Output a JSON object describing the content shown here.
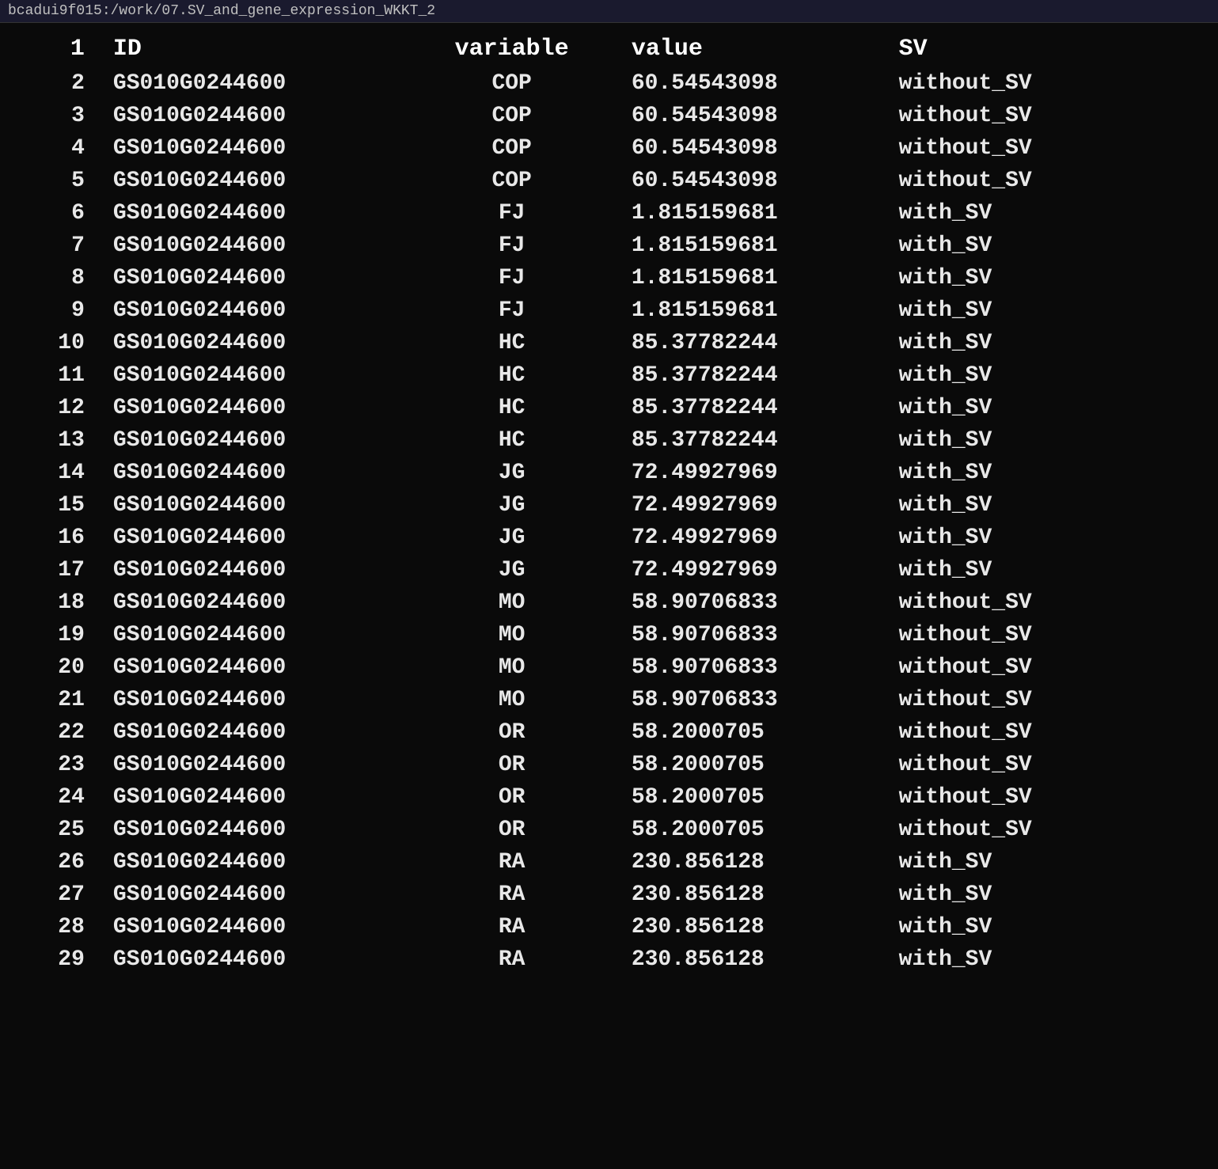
{
  "title_bar": {
    "text": "bcadui9f015:/work/07.SV_and_gene_expression_WKKT_2"
  },
  "table": {
    "headers": [
      "ID",
      "variable",
      "value",
      "SV"
    ],
    "rows": [
      {
        "id": "2",
        "gene": "GS010G0244600",
        "variable": "COP",
        "value": "60.54543098",
        "sv": "without_SV"
      },
      {
        "id": "3",
        "gene": "GS010G0244600",
        "variable": "COP",
        "value": "60.54543098",
        "sv": "without_SV"
      },
      {
        "id": "4",
        "gene": "GS010G0244600",
        "variable": "COP",
        "value": "60.54543098",
        "sv": "without_SV"
      },
      {
        "id": "5",
        "gene": "GS010G0244600",
        "variable": "COP",
        "value": "60.54543098",
        "sv": "without_SV"
      },
      {
        "id": "6",
        "gene": "GS010G0244600",
        "variable": "FJ",
        "value": "1.815159681",
        "sv": "with_SV"
      },
      {
        "id": "7",
        "gene": "GS010G0244600",
        "variable": "FJ",
        "value": "1.815159681",
        "sv": "with_SV"
      },
      {
        "id": "8",
        "gene": "GS010G0244600",
        "variable": "FJ",
        "value": "1.815159681",
        "sv": "with_SV"
      },
      {
        "id": "9",
        "gene": "GS010G0244600",
        "variable": "FJ",
        "value": "1.815159681",
        "sv": "with_SV"
      },
      {
        "id": "10",
        "gene": "GS010G0244600",
        "variable": "HC",
        "value": "85.37782244",
        "sv": "with_SV"
      },
      {
        "id": "11",
        "gene": "GS010G0244600",
        "variable": "HC",
        "value": "85.37782244",
        "sv": "with_SV"
      },
      {
        "id": "12",
        "gene": "GS010G0244600",
        "variable": "HC",
        "value": "85.37782244",
        "sv": "with_SV"
      },
      {
        "id": "13",
        "gene": "GS010G0244600",
        "variable": "HC",
        "value": "85.37782244",
        "sv": "with_SV"
      },
      {
        "id": "14",
        "gene": "GS010G0244600",
        "variable": "JG",
        "value": "72.49927969",
        "sv": "with_SV"
      },
      {
        "id": "15",
        "gene": "GS010G0244600",
        "variable": "JG",
        "value": "72.49927969",
        "sv": "with_SV"
      },
      {
        "id": "16",
        "gene": "GS010G0244600",
        "variable": "JG",
        "value": "72.49927969",
        "sv": "with_SV"
      },
      {
        "id": "17",
        "gene": "GS010G0244600",
        "variable": "JG",
        "value": "72.49927969",
        "sv": "with_SV"
      },
      {
        "id": "18",
        "gene": "GS010G0244600",
        "variable": "MO",
        "value": "58.90706833",
        "sv": "without_SV"
      },
      {
        "id": "19",
        "gene": "GS010G0244600",
        "variable": "MO",
        "value": "58.90706833",
        "sv": "without_SV"
      },
      {
        "id": "20",
        "gene": "GS010G0244600",
        "variable": "MO",
        "value": "58.90706833",
        "sv": "without_SV"
      },
      {
        "id": "21",
        "gene": "GS010G0244600",
        "variable": "MO",
        "value": "58.90706833",
        "sv": "without_SV"
      },
      {
        "id": "22",
        "gene": "GS010G0244600",
        "variable": "OR",
        "value": "58.2000705",
        "sv": "without_SV"
      },
      {
        "id": "23",
        "gene": "GS010G0244600",
        "variable": "OR",
        "value": "58.2000705",
        "sv": "without_SV"
      },
      {
        "id": "24",
        "gene": "GS010G0244600",
        "variable": "OR",
        "value": "58.2000705",
        "sv": "without_SV"
      },
      {
        "id": "25",
        "gene": "GS010G0244600",
        "variable": "OR",
        "value": "58.2000705",
        "sv": "without_SV"
      },
      {
        "id": "26",
        "gene": "GS010G0244600",
        "variable": "RA",
        "value": "230.856128",
        "sv": "with_SV"
      },
      {
        "id": "27",
        "gene": "GS010G0244600",
        "variable": "RA",
        "value": "230.856128",
        "sv": "with_SV"
      },
      {
        "id": "28",
        "gene": "GS010G0244600",
        "variable": "RA",
        "value": "230.856128",
        "sv": "with_SV"
      },
      {
        "id": "29",
        "gene": "GS010G0244600",
        "variable": "RA",
        "value": "230.856128",
        "sv": "with_SV"
      }
    ]
  }
}
